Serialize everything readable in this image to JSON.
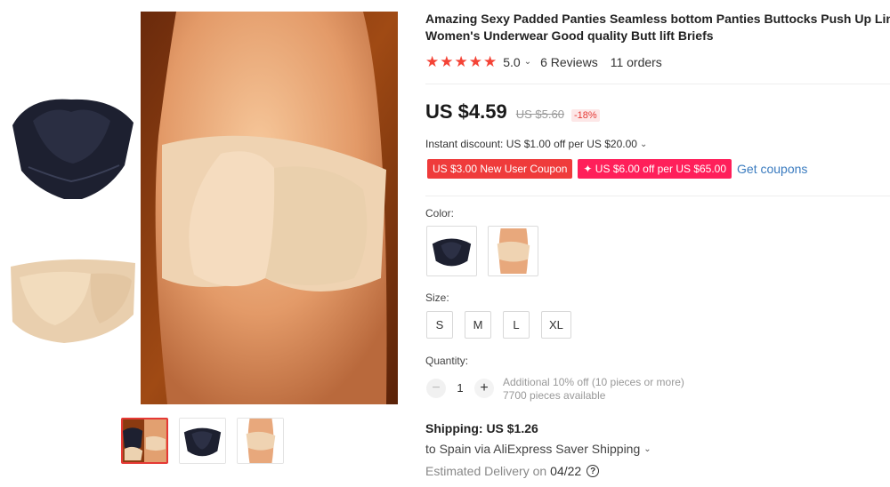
{
  "product": {
    "title_line1": "Amazing Sexy Padded Panties Seamless bottom Panties Buttocks Push Up Lingerie",
    "title_line2": "Women's Underwear Good quality Butt lift Briefs"
  },
  "rating": {
    "stars": 5,
    "value": "5.0",
    "reviews_label": "6 Reviews",
    "orders_label": "11 orders"
  },
  "price": {
    "current": "US $4.59",
    "original": "US $5.60",
    "discount_pct": "-18%"
  },
  "instant_discount": "Instant discount: US $1.00 off per US $20.00",
  "coupons": [
    {
      "label": "US $3.00 New User Coupon"
    },
    {
      "label": "✦ US $6.00 off per US $65.00"
    }
  ],
  "get_coupons_label": "Get coupons",
  "color": {
    "label": "Color:",
    "options": [
      "black-padded-brief",
      "nude-padded-brief"
    ]
  },
  "size": {
    "label": "Size:",
    "options": [
      "S",
      "M",
      "L",
      "XL"
    ]
  },
  "quantity": {
    "label": "Quantity:",
    "value": "1",
    "note_line1": "Additional 10% off (10 pieces or more)",
    "note_line2": "7700 pieces available"
  },
  "shipping": {
    "label": "Shipping:",
    "price": "US $1.26",
    "via": "to Spain via AliExpress Saver Shipping",
    "delivery_label": "Estimated Delivery on",
    "delivery_date": "04/22"
  },
  "colors": {
    "star": "#f44336",
    "coupon_red": "#ef3b3b",
    "coupon_pink": "#ff1f5a",
    "link": "#3a7bbf"
  }
}
